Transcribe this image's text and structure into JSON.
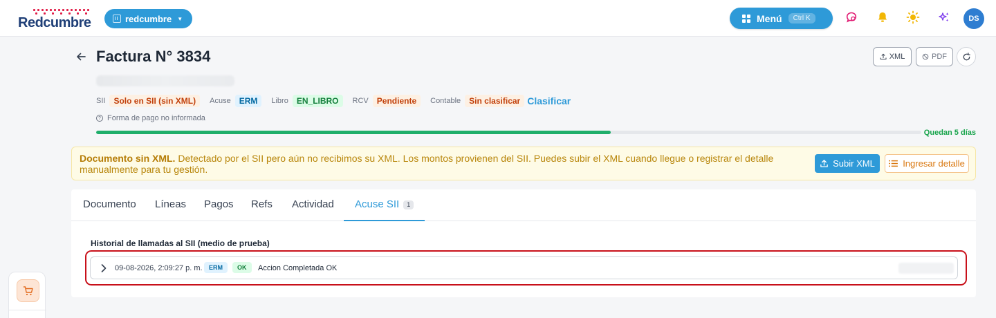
{
  "app": {
    "logo_text": "Redcumbre",
    "org_name": "redcumbre",
    "menu_label": "Menú",
    "menu_shortcut": "Ctrl K",
    "user_initials": "DS"
  },
  "header": {
    "title": "Factura N° 3834",
    "xml_button": "XML",
    "pdf_button": "PDF"
  },
  "status": {
    "sii_label": "SII",
    "sii_value": "Solo en SII (sin XML)",
    "acuse_label": "Acuse",
    "acuse_value": "ERM",
    "libro_label": "Libro",
    "libro_value": "EN_LIBRO",
    "rcv_label": "RCV",
    "rcv_value": "Pendiente",
    "contable_label": "Contable",
    "contable_value": "Sin clasificar",
    "classify_link": "Clasificar",
    "payment_note": "Forma de pago no informada"
  },
  "deadline": {
    "label": "Quedan 5 días",
    "progress_fraction": 0.624
  },
  "alert": {
    "title": "Documento sin XML.",
    "message": "Detectado por el SII pero aún no recibimos su XML. Los montos provienen del SII. Puedes subir el XML cuando llegue o registrar el detalle manualmente para tu gestión.",
    "upload_button": "Subir XML",
    "manual_button": "Ingresar detalle"
  },
  "tabs": [
    {
      "label": "Documento"
    },
    {
      "label": "Líneas"
    },
    {
      "label": "Pagos"
    },
    {
      "label": "Refs"
    },
    {
      "label": "Actividad"
    },
    {
      "label": "Acuse SII",
      "count": "1"
    }
  ],
  "history": {
    "title": "Historial de llamadas al SII (medio de prueba)",
    "rows": [
      {
        "timestamp": "09-08-2026, 2:09:27 p. m.",
        "tag_type": "ERM",
        "tag_status": "OK",
        "message": "Accion Completada OK"
      }
    ]
  },
  "colors": {
    "accent": "#2e9ad8",
    "brand_navy": "#1f3f77",
    "brand_red": "#e11d48",
    "highlight_red": "#c8101a",
    "progress_green": "#1fae6b"
  }
}
